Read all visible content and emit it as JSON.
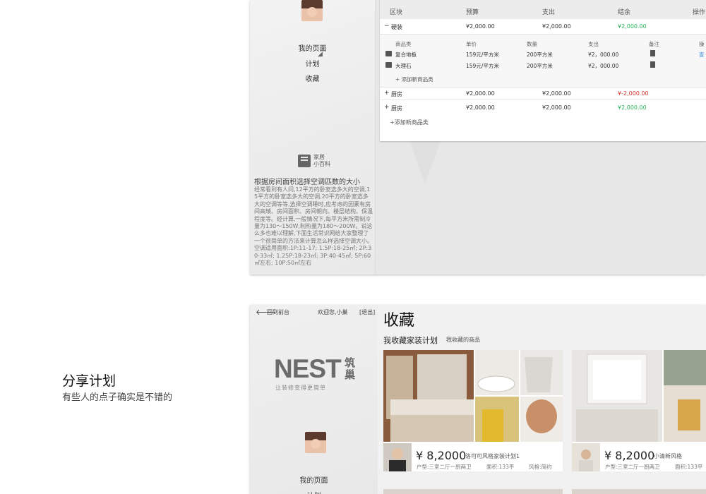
{
  "caption": {
    "title": "分享计划",
    "subtitle": "有些人的点子确实是不错的"
  },
  "panel1": {
    "nav": [
      "我的页面",
      "计划",
      "收藏"
    ],
    "wiki": {
      "line1": "家居",
      "line2": "小百科"
    },
    "article": {
      "title": "根据房间面积选择空调匹数的大小",
      "body": "经常看到有人问,12平方的卧室选多大的空调,15平方的卧室选多大的空调,20平方的卧室选多大的空调等等,选择空调睡时,应考虑的因素有房间高矮、房间面积、房间朝向、楼层结构、保温程度等。经计算,一般情况下,每平方米所需制冷量为130～150W,制热量为180～200W。说这么多也难以理解,下面生活常识网给大家整理了一个很简单的方法来计算怎么样选择空调大小。空调适用面积:1P:11-17;  1.5P:18-25㎡;  2P:30-33㎡;  1.25P:18-23㎡;  3P:40-45㎡;  5P:60㎡左右;  10P:50㎡左右"
    },
    "budget": {
      "headers": [
        "区块",
        "预算",
        "支出",
        "结余",
        "操作"
      ],
      "rows": [
        {
          "expand": "−",
          "name": "硬装",
          "budget": "¥2,000.00",
          "spent": "¥2,000.00",
          "balance": "¥2,000.00",
          "status": "positive"
        },
        {
          "expand": "+",
          "name": "厨房",
          "budget": "¥2,000.00",
          "spent": "¥2,000.00",
          "balance": "¥-2,000.00",
          "status": "negative"
        },
        {
          "expand": "+",
          "name": "厨房",
          "budget": "¥2,000.00",
          "spent": "¥2,000.00",
          "balance": "¥2,000.00",
          "status": "positive"
        }
      ],
      "sub_headers": [
        "商品类",
        "单价",
        "数量",
        "支出",
        "备注",
        "操"
      ],
      "sub_items": [
        {
          "name": "复合地板",
          "unit_price": "159元/平方米",
          "quantity": "200平方米",
          "spent": "¥2，000.00",
          "action": "查"
        },
        {
          "name": "大理石",
          "unit_price": "159元/平方米",
          "quantity": "200平方米",
          "spent": "¥2，000.00",
          "action": ""
        }
      ],
      "add_item": "+ 添加新商品类",
      "add_category": "+添加新商品类"
    }
  },
  "panel2": {
    "back": "回到前台",
    "welcome": "欢迎您,小巢",
    "logout": "[退出]",
    "logo": {
      "en": "NEST",
      "cn": "筑巢",
      "slogan": "让装修变得更简单"
    },
    "nav": [
      "我的页面",
      "计划"
    ],
    "page_title": "收藏",
    "tabs": {
      "active": "我收藏家装计划",
      "other": "我收藏的商品"
    },
    "cards": [
      {
        "price": "¥ 8,2000",
        "name": "洛可可风格家装计划1",
        "layout": "户型:三室二厅一厨两卫",
        "area": "面积:133平",
        "style": "风格:简约"
      },
      {
        "price": "¥ 8,2000",
        "name": "小清新风格",
        "layout": "户型:三室二厅一厨两卫",
        "area": "面积:133平",
        "style": ""
      }
    ]
  },
  "colors": {
    "positive": "#27b35a",
    "negative": "#d0342c",
    "text": "#333333"
  }
}
